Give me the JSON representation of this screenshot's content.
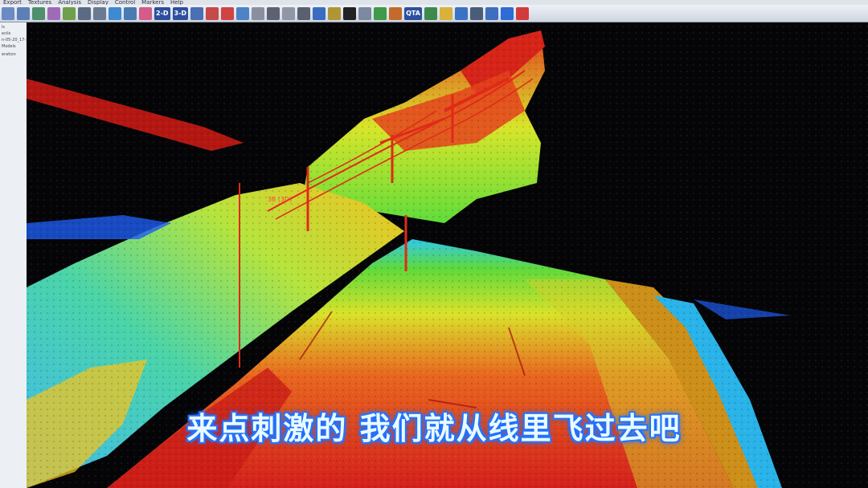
{
  "menu": [
    "Export",
    "Textures",
    "Analysis",
    "Display",
    "Control",
    "Markers",
    "Help"
  ],
  "toolbar": {
    "items": [
      {
        "name": "open-icon",
        "color": "#6a8bc4"
      },
      {
        "name": "save-icon",
        "color": "#5c7fb8"
      },
      {
        "name": "layers-icon",
        "color": "#4f8f6a"
      },
      {
        "name": "pointcloud-icon",
        "color": "#a06bb5"
      },
      {
        "name": "terrain-icon",
        "color": "#6f9f4a"
      },
      {
        "name": "grid-icon",
        "color": "#5b6b84"
      },
      {
        "name": "filter-icon",
        "color": "#6c7a90"
      },
      {
        "name": "globe-icon",
        "color": "#3c8bd0"
      },
      {
        "name": "measure-icon",
        "color": "#4a7bb0"
      },
      {
        "name": "color-icon",
        "color": "#d45b8a"
      }
    ],
    "view2d_label": "2-D",
    "view3d_label": "3-D",
    "qta_label": "QTA",
    "right_items": [
      {
        "name": "zoom-extent-icon",
        "color": "#4a6fb2"
      },
      {
        "name": "pan-icon",
        "color": "#c74a4a"
      },
      {
        "name": "pin-icon",
        "color": "#d14343"
      },
      {
        "name": "select-icon",
        "color": "#4c83c6"
      },
      {
        "name": "square-icon",
        "color": "#8a8fa0"
      },
      {
        "name": "zoom-icon",
        "color": "#5d6170"
      },
      {
        "name": "ellipse-icon",
        "color": "#8f96a6"
      },
      {
        "name": "scissors-icon",
        "color": "#5b6070"
      },
      {
        "name": "frame-icon",
        "color": "#3a6cc0"
      },
      {
        "name": "ruler-icon",
        "color": "#b09535"
      },
      {
        "name": "target-icon",
        "color": "#222222"
      },
      {
        "name": "surface-icon",
        "color": "#7b8aa0"
      },
      {
        "name": "tree-icon",
        "color": "#3f9a4a"
      },
      {
        "name": "palette-icon",
        "color": "#c46b2b"
      },
      {
        "name": "export-icon",
        "color": "#3d8a4f"
      },
      {
        "name": "bulb-icon",
        "color": "#d8b23a"
      },
      {
        "name": "chart-icon",
        "color": "#3a73c6"
      },
      {
        "name": "edit-icon",
        "color": "#4a5c78"
      },
      {
        "name": "settings-icon",
        "color": "#3d6fbe"
      },
      {
        "name": "help-icon",
        "color": "#2d6bd6"
      },
      {
        "name": "close-icon",
        "color": "#d23b3b"
      }
    ]
  },
  "sidepanel": {
    "lines": [
      "",
      "ls",
      "ecils",
      "n-05-20_17-1",
      "Models",
      "",
      "eration"
    ]
  },
  "viewport": {
    "label_3d": "38 (3D)"
  },
  "caption": "来点刺激的 我们就从线里飞过去吧"
}
